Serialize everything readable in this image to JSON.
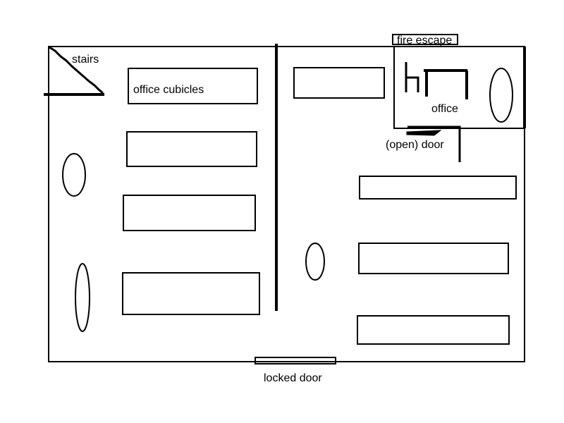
{
  "labels": {
    "stairs": "stairs",
    "office_cubicles": "office cubicles",
    "fire_escape": "fire escape",
    "office": "office",
    "open_door": "(open) door",
    "locked_door": "locked door"
  },
  "colors": {
    "stroke": "#000000",
    "background": "#ffffff"
  }
}
